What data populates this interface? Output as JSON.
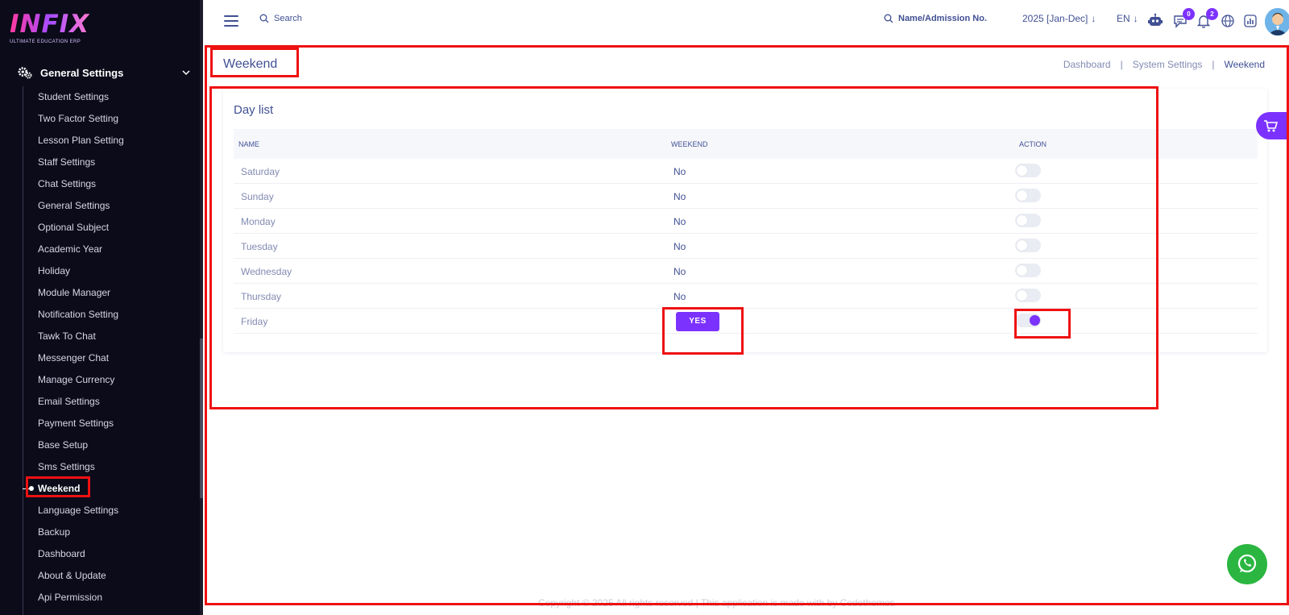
{
  "brand": {
    "logo_text": "INFIX",
    "logo_subtitle": "ULTIMATE EDUCATION ERP"
  },
  "sidebar": {
    "section_label": "General Settings",
    "items": [
      {
        "label": "Student Settings"
      },
      {
        "label": "Two Factor Setting"
      },
      {
        "label": "Lesson Plan Setting"
      },
      {
        "label": "Staff Settings"
      },
      {
        "label": "Chat Settings"
      },
      {
        "label": "General Settings"
      },
      {
        "label": "Optional Subject"
      },
      {
        "label": "Academic Year"
      },
      {
        "label": "Holiday"
      },
      {
        "label": "Module Manager"
      },
      {
        "label": "Notification Setting"
      },
      {
        "label": "Tawk To Chat"
      },
      {
        "label": "Messenger Chat"
      },
      {
        "label": "Manage Currency"
      },
      {
        "label": "Email Settings"
      },
      {
        "label": "Payment Settings"
      },
      {
        "label": "Base Setup"
      },
      {
        "label": "Sms Settings"
      },
      {
        "label": "Weekend",
        "active": true
      },
      {
        "label": "Language Settings"
      },
      {
        "label": "Backup"
      },
      {
        "label": "Dashboard"
      },
      {
        "label": "About & Update"
      },
      {
        "label": "Api Permission"
      }
    ]
  },
  "topbar": {
    "search_label": "Search",
    "admission_search_label": "Name/Admission No.",
    "academic_year": "2025 [Jan-Dec]",
    "language": "EN",
    "messages_badge": "0",
    "notifications_badge": "2"
  },
  "page": {
    "title": "Weekend",
    "breadcrumb": [
      "Dashboard",
      "System Settings",
      "Weekend"
    ]
  },
  "day_list": {
    "title": "Day list",
    "columns": [
      "NAME",
      "WEEKEND",
      "ACTION"
    ],
    "rows": [
      {
        "name": "Saturday",
        "weekend": "No",
        "enabled": false
      },
      {
        "name": "Sunday",
        "weekend": "No",
        "enabled": false
      },
      {
        "name": "Monday",
        "weekend": "No",
        "enabled": false
      },
      {
        "name": "Tuesday",
        "weekend": "No",
        "enabled": false
      },
      {
        "name": "Wednesday",
        "weekend": "No",
        "enabled": false
      },
      {
        "name": "Thursday",
        "weekend": "No",
        "enabled": false
      },
      {
        "name": "Friday",
        "weekend": "YES",
        "enabled": true
      }
    ]
  },
  "footer": {
    "text": "Copyright © 2025 All rights reserved | This application is made with by Codethemes"
  },
  "colors": {
    "accent": "#7c32ff",
    "text_primary": "#415094",
    "text_muted": "#828bb2",
    "sidebar_bg": "#0b0b1a",
    "highlight": "#ee1111",
    "whatsapp": "#2bb641"
  }
}
